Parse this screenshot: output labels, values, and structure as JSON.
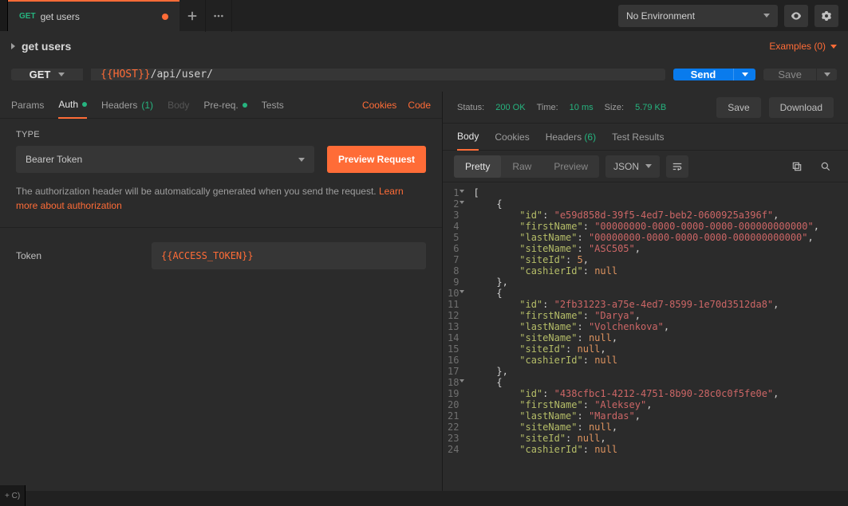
{
  "env_selector": "No Environment",
  "tab": {
    "method": "GET",
    "title": "get users"
  },
  "title_row": "get users",
  "examples": "Examples (0)",
  "method": "GET",
  "url_var": "{{HOST}}",
  "url_path": "/api/user/",
  "send": "Send",
  "save": "Save",
  "req_tabs": {
    "params": "Params",
    "auth": "Auth",
    "headers": "Headers",
    "headers_count": "(1)",
    "body": "Body",
    "prereq": "Pre-req.",
    "tests": "Tests",
    "cookies": "Cookies",
    "code": "Code"
  },
  "auth": {
    "type_label": "TYPE",
    "type_value": "Bearer Token",
    "preview": "Preview Request",
    "help": "The authorization header will be automatically generated when you send the request. ",
    "help_link": "Learn more about authorization",
    "token_label": "Token",
    "token_value": "{{ACCESS_TOKEN}}"
  },
  "status": {
    "prefix": "Status:",
    "status": "200 OK",
    "time_prefix": "Time:",
    "time": "10 ms",
    "size_prefix": "Size:",
    "size": "5.79 KB",
    "save": "Save",
    "download": "Download"
  },
  "resp_tabs": {
    "body": "Body",
    "cookies": "Cookies",
    "headers": "Headers",
    "headers_count": "(6)",
    "tests": "Test Results"
  },
  "code_toolbar": {
    "pretty": "Pretty",
    "raw": "Raw",
    "preview": "Preview",
    "fmt": "JSON"
  },
  "response": [
    {
      "ln": 1,
      "fold": true,
      "indent": 0,
      "tokens": [
        [
          "p",
          "["
        ]
      ]
    },
    {
      "ln": 2,
      "fold": true,
      "indent": 1,
      "tokens": [
        [
          "p",
          "{"
        ]
      ]
    },
    {
      "ln": 3,
      "indent": 2,
      "tokens": [
        [
          "k",
          "\"id\""
        ],
        [
          "p",
          ": "
        ],
        [
          "s",
          "\"e59d858d-39f5-4ed7-beb2-0600925a396f\""
        ],
        [
          "p",
          ","
        ]
      ]
    },
    {
      "ln": 4,
      "indent": 2,
      "tokens": [
        [
          "k",
          "\"firstName\""
        ],
        [
          "p",
          ": "
        ],
        [
          "s",
          "\"00000000-0000-0000-0000-000000000000\""
        ],
        [
          "p",
          ","
        ]
      ]
    },
    {
      "ln": 5,
      "indent": 2,
      "tokens": [
        [
          "k",
          "\"lastName\""
        ],
        [
          "p",
          ": "
        ],
        [
          "s",
          "\"00000000-0000-0000-0000-000000000000\""
        ],
        [
          "p",
          ","
        ]
      ]
    },
    {
      "ln": 6,
      "indent": 2,
      "tokens": [
        [
          "k",
          "\"siteName\""
        ],
        [
          "p",
          ": "
        ],
        [
          "s",
          "\"ASC505\""
        ],
        [
          "p",
          ","
        ]
      ]
    },
    {
      "ln": 7,
      "indent": 2,
      "tokens": [
        [
          "k",
          "\"siteId\""
        ],
        [
          "p",
          ": "
        ],
        [
          "n",
          "5"
        ],
        [
          "p",
          ","
        ]
      ]
    },
    {
      "ln": 8,
      "indent": 2,
      "tokens": [
        [
          "k",
          "\"cashierId\""
        ],
        [
          "p",
          ": "
        ],
        [
          "nu",
          "null"
        ]
      ]
    },
    {
      "ln": 9,
      "indent": 1,
      "tokens": [
        [
          "p",
          "},"
        ]
      ]
    },
    {
      "ln": 10,
      "fold": true,
      "indent": 1,
      "tokens": [
        [
          "p",
          "{"
        ]
      ]
    },
    {
      "ln": 11,
      "indent": 2,
      "tokens": [
        [
          "k",
          "\"id\""
        ],
        [
          "p",
          ": "
        ],
        [
          "s",
          "\"2fb31223-a75e-4ed7-8599-1e70d3512da8\""
        ],
        [
          "p",
          ","
        ]
      ]
    },
    {
      "ln": 12,
      "indent": 2,
      "tokens": [
        [
          "k",
          "\"firstName\""
        ],
        [
          "p",
          ": "
        ],
        [
          "s",
          "\"Darya\""
        ],
        [
          "p",
          ","
        ]
      ]
    },
    {
      "ln": 13,
      "indent": 2,
      "tokens": [
        [
          "k",
          "\"lastName\""
        ],
        [
          "p",
          ": "
        ],
        [
          "s",
          "\"Volchenkova\""
        ],
        [
          "p",
          ","
        ]
      ]
    },
    {
      "ln": 14,
      "indent": 2,
      "tokens": [
        [
          "k",
          "\"siteName\""
        ],
        [
          "p",
          ": "
        ],
        [
          "nu",
          "null"
        ],
        [
          "p",
          ","
        ]
      ]
    },
    {
      "ln": 15,
      "indent": 2,
      "tokens": [
        [
          "k",
          "\"siteId\""
        ],
        [
          "p",
          ": "
        ],
        [
          "nu",
          "null"
        ],
        [
          "p",
          ","
        ]
      ]
    },
    {
      "ln": 16,
      "indent": 2,
      "tokens": [
        [
          "k",
          "\"cashierId\""
        ],
        [
          "p",
          ": "
        ],
        [
          "nu",
          "null"
        ]
      ]
    },
    {
      "ln": 17,
      "indent": 1,
      "tokens": [
        [
          "p",
          "},"
        ]
      ]
    },
    {
      "ln": 18,
      "fold": true,
      "indent": 1,
      "tokens": [
        [
          "p",
          "{"
        ]
      ]
    },
    {
      "ln": 19,
      "indent": 2,
      "tokens": [
        [
          "k",
          "\"id\""
        ],
        [
          "p",
          ": "
        ],
        [
          "s",
          "\"438cfbc1-4212-4751-8b90-28c0c0f5fe0e\""
        ],
        [
          "p",
          ","
        ]
      ]
    },
    {
      "ln": 20,
      "indent": 2,
      "tokens": [
        [
          "k",
          "\"firstName\""
        ],
        [
          "p",
          ": "
        ],
        [
          "s",
          "\"Aleksey\""
        ],
        [
          "p",
          ","
        ]
      ]
    },
    {
      "ln": 21,
      "indent": 2,
      "tokens": [
        [
          "k",
          "\"lastName\""
        ],
        [
          "p",
          ": "
        ],
        [
          "s",
          "\"Mardas\""
        ],
        [
          "p",
          ","
        ]
      ]
    },
    {
      "ln": 22,
      "indent": 2,
      "tokens": [
        [
          "k",
          "\"siteName\""
        ],
        [
          "p",
          ": "
        ],
        [
          "nu",
          "null"
        ],
        [
          "p",
          ","
        ]
      ]
    },
    {
      "ln": 23,
      "indent": 2,
      "tokens": [
        [
          "k",
          "\"siteId\""
        ],
        [
          "p",
          ": "
        ],
        [
          "nu",
          "null"
        ],
        [
          "p",
          ","
        ]
      ]
    },
    {
      "ln": 24,
      "indent": 2,
      "tokens": [
        [
          "k",
          "\"cashierId\""
        ],
        [
          "p",
          ": "
        ],
        [
          "nu",
          "null"
        ]
      ]
    }
  ],
  "bottom_left": "+ C)"
}
